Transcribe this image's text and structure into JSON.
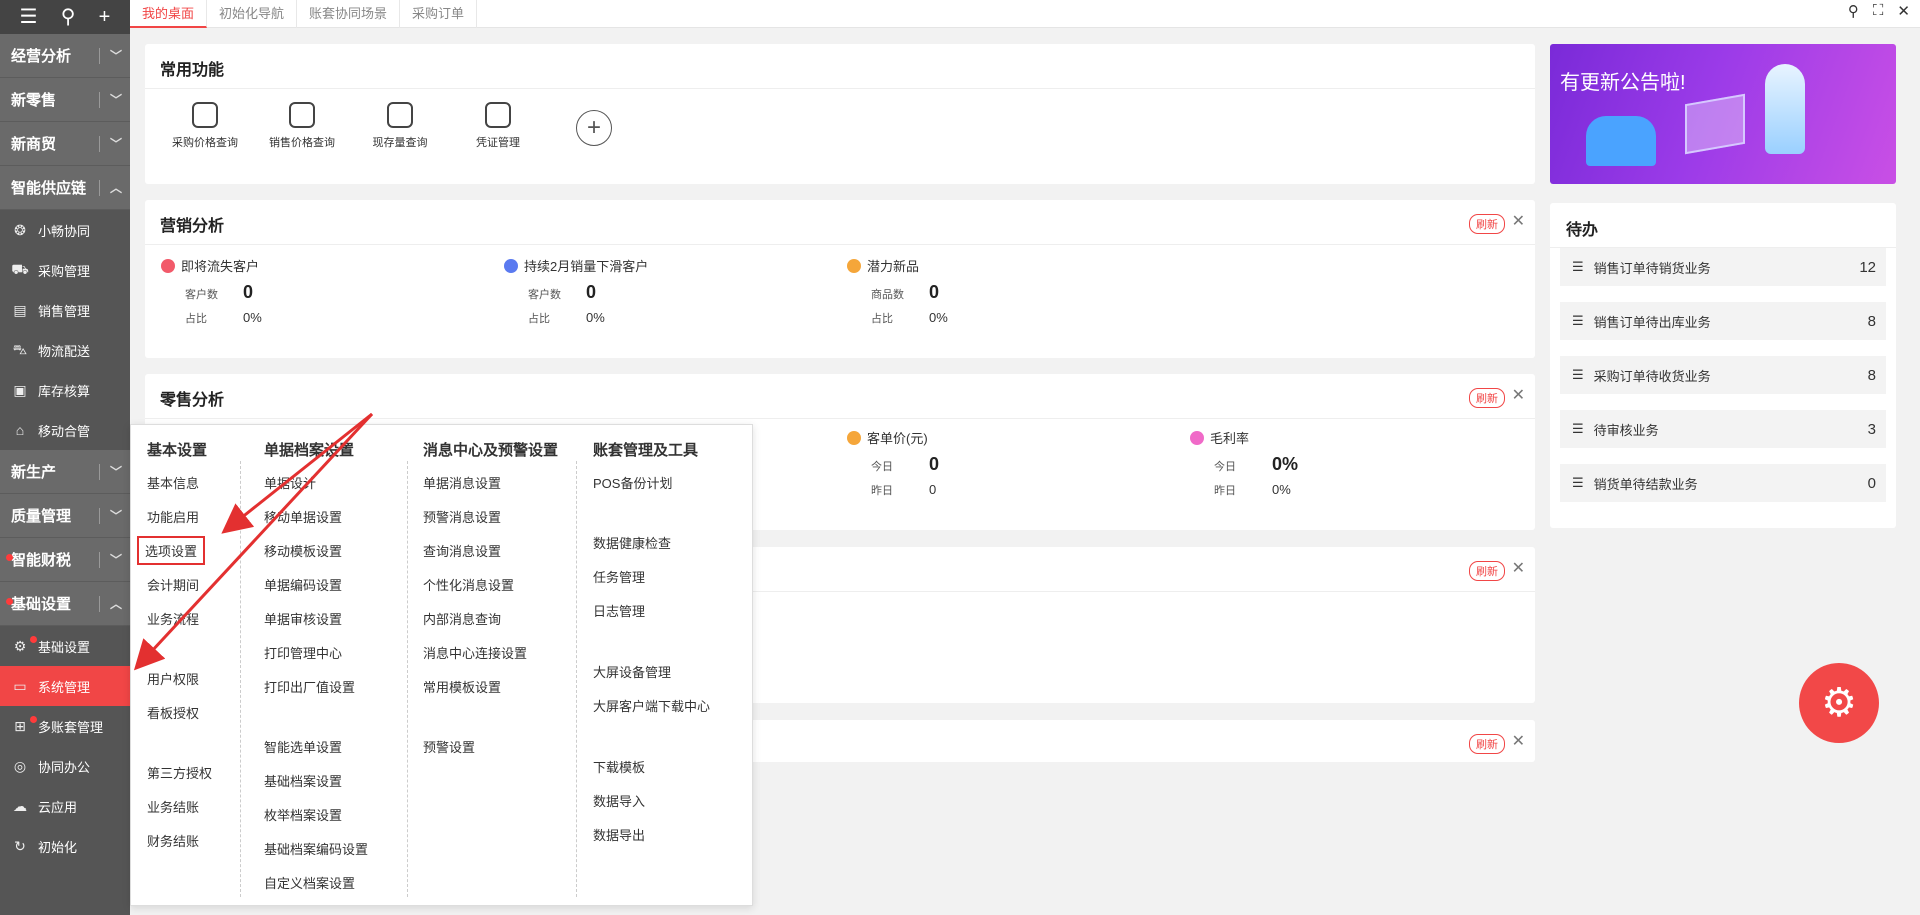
{
  "sidebar": {
    "top_icons": [
      "menu-icon",
      "search-icon",
      "plus-icon"
    ],
    "groups": [
      {
        "label": "经营分析"
      },
      {
        "label": "新零售"
      },
      {
        "label": "新商贸"
      },
      {
        "label": "智能供应链"
      }
    ],
    "supply_items": [
      {
        "label": "小畅协同"
      },
      {
        "label": "采购管理"
      },
      {
        "label": "销售管理"
      },
      {
        "label": "物流配送"
      },
      {
        "label": "库存核算"
      },
      {
        "label": "移动合管"
      }
    ],
    "groups2": [
      {
        "label": "新生产"
      },
      {
        "label": "质量管理"
      },
      {
        "label": "智能财税"
      },
      {
        "label": "基础设置"
      }
    ],
    "base_items": [
      {
        "label": "基础设置"
      },
      {
        "label": "系统管理"
      },
      {
        "label": "多账套管理"
      },
      {
        "label": "协同办公"
      },
      {
        "label": "云应用"
      },
      {
        "label": "初始化"
      }
    ]
  },
  "tabs": [
    "我的桌面",
    "初始化导航",
    "账套协同场景",
    "采购订单"
  ],
  "common": {
    "title": "常用功能",
    "items": [
      "采购价格查询",
      "销售价格查询",
      "现存量查询",
      "凭证管理"
    ],
    "add": "+"
  },
  "marketing": {
    "title": "营销分析",
    "refresh": "刷新",
    "metrics": [
      {
        "name": "即将流失客户",
        "color": "#f25a6a",
        "l1": "客户数",
        "v1": "0",
        "l2": "占比",
        "v2": "0%"
      },
      {
        "name": "持续2月销量下滑客户",
        "color": "#5a7af0",
        "l1": "客户数",
        "v1": "0",
        "l2": "占比",
        "v2": "0%"
      },
      {
        "name": "潜力新品",
        "color": "#f5a63a",
        "l1": "商品数",
        "v1": "0",
        "l2": "占比",
        "v2": "0%"
      }
    ]
  },
  "retail": {
    "title": "零售分析",
    "refresh": "刷新",
    "metrics": [
      {
        "name": "客单价(元)",
        "color": "#f5a63a",
        "l1": "今日",
        "v1": "0",
        "l2": "昨日",
        "v2": "0"
      },
      {
        "name": "毛利率",
        "color": "#f06ac8",
        "l1": "今日",
        "v1": "0%",
        "l2": "昨日",
        "v2": "0%"
      }
    ]
  },
  "card3": {
    "refresh": "刷新"
  },
  "card4": {
    "refresh": "刷新"
  },
  "banner": {
    "text": "有更新公告啦!"
  },
  "todo": {
    "title": "待办",
    "items": [
      {
        "label": "销售订单待销货业务",
        "count": "12"
      },
      {
        "label": "销售订单待出库业务",
        "count": "8"
      },
      {
        "label": "采购订单待收货业务",
        "count": "8"
      },
      {
        "label": "待审核业务",
        "count": "3"
      },
      {
        "label": "销货单待结款业务",
        "count": "0"
      }
    ]
  },
  "menu": {
    "col1": {
      "title": "基本设置",
      "items": [
        "基本信息",
        "功能启用",
        "选项设置",
        "会计期间",
        "业务流程",
        "用户权限",
        "看板授权",
        "第三方授权",
        "业务结账",
        "财务结账"
      ]
    },
    "col2": {
      "title": "单据档案设置",
      "items": [
        "单据设计",
        "移动单据设置",
        "移动模板设置",
        "单据编码设置",
        "单据审核设置",
        "打印管理中心",
        "打印出厂值设置",
        "智能选单设置",
        "基础档案设置",
        "枚举档案设置",
        "基础档案编码设置",
        "自定义档案设置"
      ]
    },
    "col3": {
      "title": "消息中心及预警设置",
      "items": [
        "单据消息设置",
        "预警消息设置",
        "查询消息设置",
        "个性化消息设置",
        "内部消息查询",
        "消息中心连接设置",
        "常用模板设置",
        "预警设置"
      ]
    },
    "col4": {
      "title": "账套管理及工具",
      "items": [
        "POS备份计划",
        "数据健康检查",
        "任务管理",
        "日志管理",
        "大屏设备管理",
        "大屏客户端下载中心",
        "下载模板",
        "数据导入",
        "数据导出"
      ]
    }
  }
}
